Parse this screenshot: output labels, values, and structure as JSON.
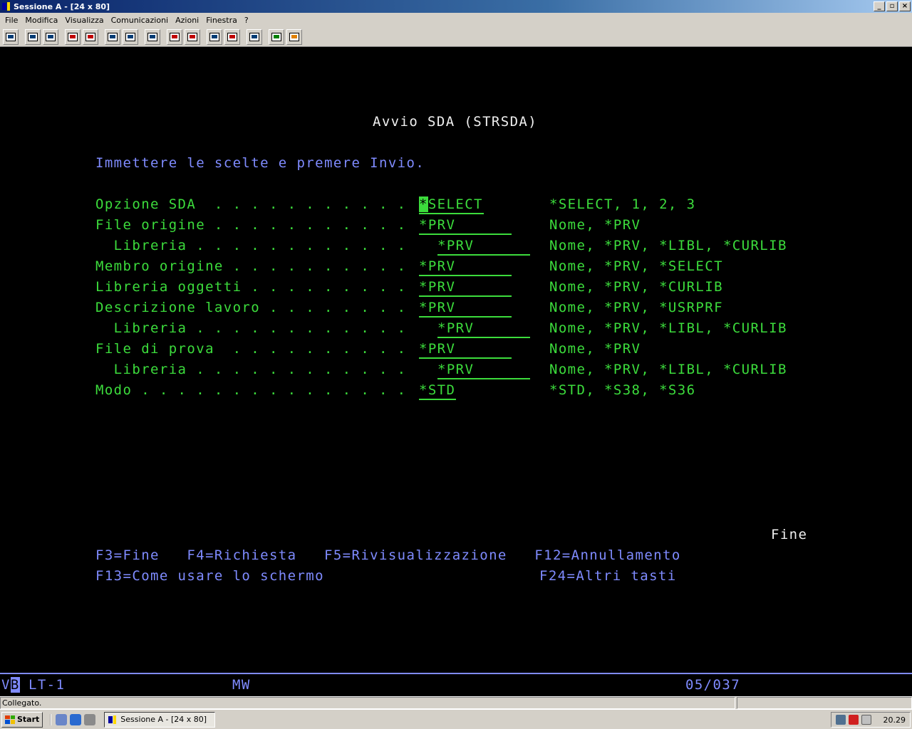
{
  "window": {
    "title": "Sessione A - [24 x 80]",
    "min_label": "_",
    "max_label": "▫",
    "close_label": "×"
  },
  "menu": [
    "File",
    "Modifica",
    "Visualizza",
    "Comunicazioni",
    "Azioni",
    "Finestra",
    "?"
  ],
  "toolbar_icons": [
    "print-screen",
    "copy",
    "paste",
    "send",
    "receive",
    "display-macro",
    "display-keypad",
    "record-macro",
    "play-macro",
    "stop-macro",
    "macro-options",
    "edit-macro",
    "clipboard",
    "globe",
    "support"
  ],
  "screen": {
    "title": "Avvio SDA (STRSDA)",
    "instruction": "Immettere le scelte e premere Invio.",
    "fields": [
      {
        "label": "Opzione SDA  . . . . . . . . . . .",
        "value": "*SELECT",
        "hint": "*SELECT, 1, 2, 3"
      },
      {
        "label": "File origine . . . . . . . . . . .",
        "value": "*PRV",
        "hint": "Nome, *PRV"
      },
      {
        "label": "  Libreria . . . . . . . . . . . .",
        "value": "*PRV",
        "hint": "Nome, *PRV, *LIBL, *CURLIB"
      },
      {
        "label": "Membro origine . . . . . . . . . .",
        "value": "*PRV",
        "hint": "Nome, *PRV, *SELECT"
      },
      {
        "label": "Libreria oggetti . . . . . . . . .",
        "value": "*PRV",
        "hint": "Nome, *PRV, *CURLIB"
      },
      {
        "label": "Descrizione lavoro . . . . . . . .",
        "value": "*PRV",
        "hint": "Nome, *PRV, *USRPRF"
      },
      {
        "label": "  Libreria . . . . . . . . . . . .",
        "value": "*PRV",
        "hint": "Nome, *PRV, *LIBL, *CURLIB"
      },
      {
        "label": "File di prova  . . . . . . . . . .",
        "value": "*PRV",
        "hint": "Nome, *PRV"
      },
      {
        "label": "  Libreria . . . . . . . . . . . .",
        "value": "*PRV",
        "hint": "Nome, *PRV, *LIBL, *CURLIB"
      },
      {
        "label": "Modo . . . . . . . . . . . . . . .",
        "value": "*STD",
        "hint": "*STD, *S38, *S36"
      }
    ],
    "more_indicator": "Fine",
    "fkeys_line1": "F3=Fine   F4=Richiesta   F5=Rivisualizzazione   F12=Annullamento",
    "fkeys_line2_left": "F13=Come usare lo schermo",
    "fkeys_line2_right": "F24=Altri tasti"
  },
  "oia": {
    "vb_prefix": "V",
    "vb_cursor": "B",
    "session": "LT-1",
    "mw": "MW",
    "cursor_pos": "05/037"
  },
  "statusbar": {
    "text": "Collegato."
  },
  "taskbar": {
    "start_label": "Start",
    "task_label": "Sessione A - [24 x 80]",
    "clock": "20.29"
  },
  "colors": {
    "green": "#3cdc3c",
    "blue": "#7f8bff",
    "white": "#f0f0f0"
  }
}
